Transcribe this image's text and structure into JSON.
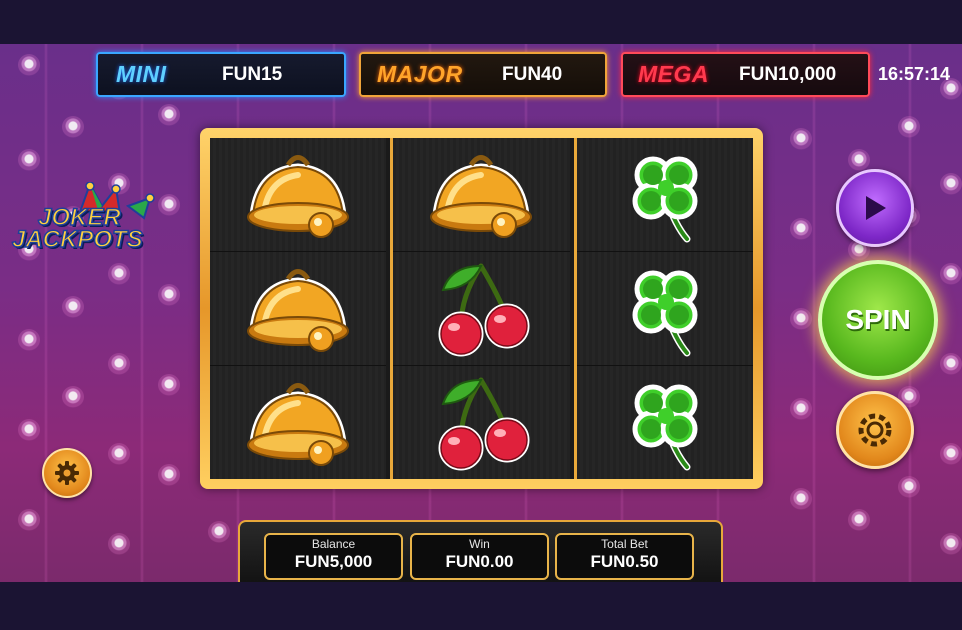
{
  "jackpots": {
    "mini": {
      "name": "MINI",
      "value": "FUN15"
    },
    "major": {
      "name": "MAJOR",
      "value": "FUN40"
    },
    "mega": {
      "name": "MEGA",
      "value": "FUN10,000"
    }
  },
  "clock": "16:57:14",
  "logo": {
    "line1": "JOKER",
    "line2": "JACKPOTS"
  },
  "reels": [
    [
      "bell",
      "bell",
      "bell"
    ],
    [
      "bell",
      "cherries",
      "cherries"
    ],
    [
      "clover",
      "clover",
      "clover"
    ]
  ],
  "buttons": {
    "spin": "SPIN",
    "play_icon": "play-icon",
    "chip_icon": "chip-icon",
    "settings_icon": "gear-icon"
  },
  "info": {
    "balance": {
      "label": "Balance",
      "value": "FUN5,000"
    },
    "win": {
      "label": "Win",
      "value": "FUN0.00"
    },
    "total_bet": {
      "label": "Total Bet",
      "value": "FUN0.50"
    }
  },
  "colors": {
    "mini": "#5fd0ff",
    "major": "#ffa42a",
    "mega": "#ff3a4e",
    "spin": "#58b81e",
    "frame": "#e8a83a"
  }
}
